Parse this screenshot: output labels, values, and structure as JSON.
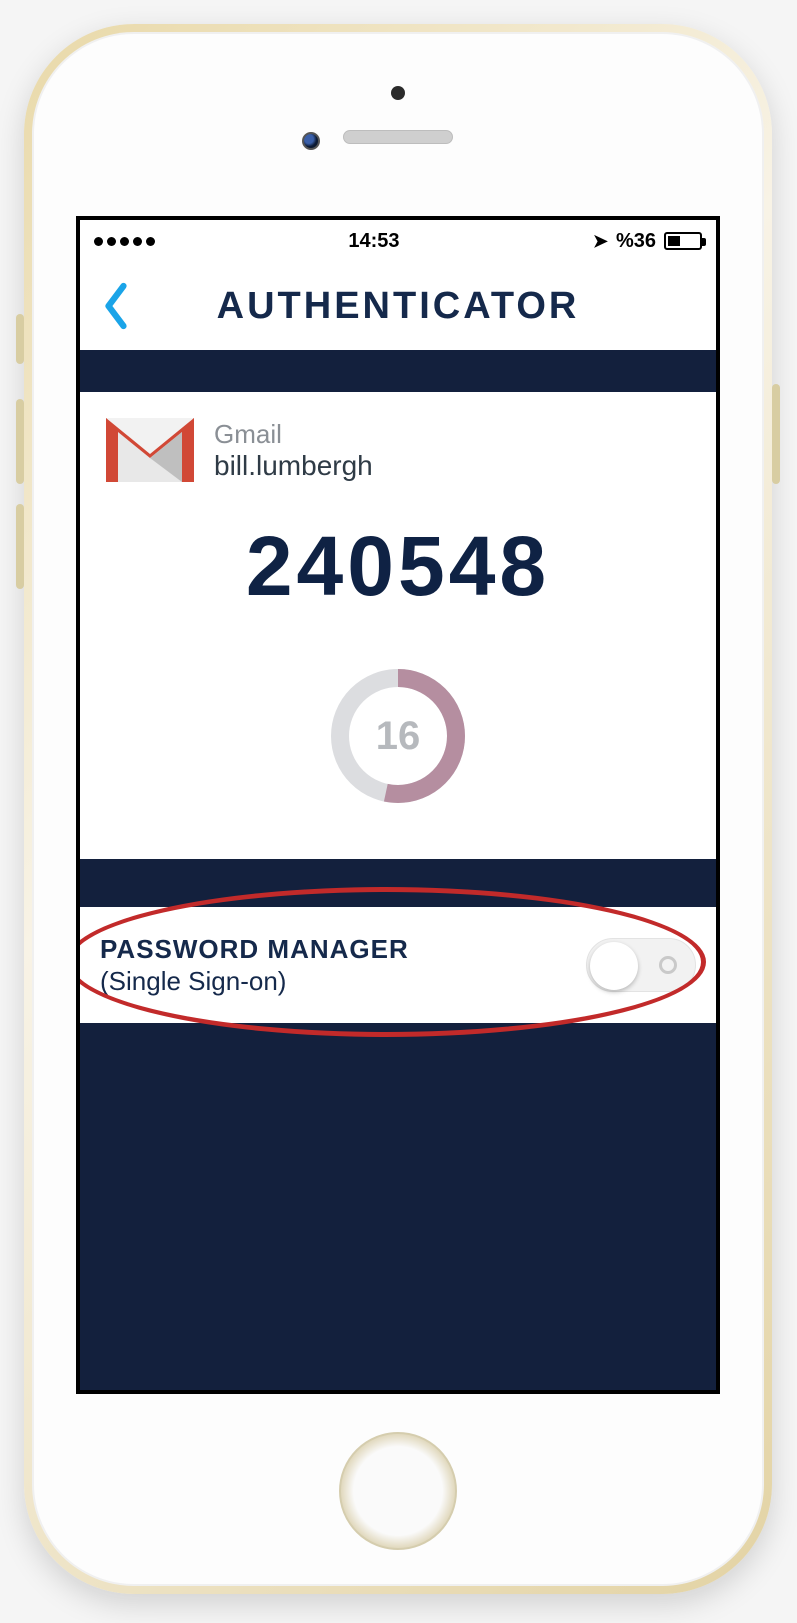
{
  "status": {
    "time": "14:53",
    "battery_text": "%36",
    "battery_fill_pct": 36
  },
  "nav": {
    "title": "AUTHENTICATOR"
  },
  "account": {
    "service": "Gmail",
    "username": "bill.lumbergh",
    "code": "240548",
    "countdown_seconds": "16",
    "countdown_total": 30
  },
  "password_manager": {
    "line1": "PASSWORD MANAGER",
    "line2": "(Single Sign-on)",
    "enabled": false
  },
  "colors": {
    "brand_dark": "#13203d",
    "text_dark": "#15294b",
    "ring_fg": "#b58ea0",
    "ring_bg": "#dcdde0",
    "annotation": "#c22a2a"
  },
  "icons": {
    "back": "chevron-left-icon",
    "service": "gmail-icon",
    "location": "location-arrow-icon",
    "battery": "battery-icon"
  }
}
